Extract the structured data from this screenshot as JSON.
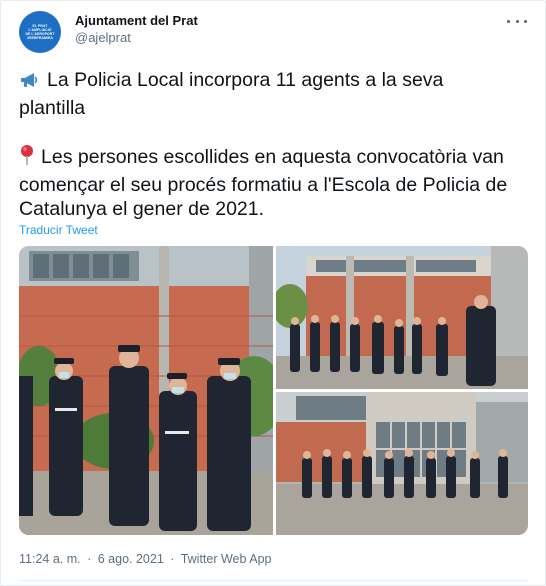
{
  "account": {
    "display_name": "Ajuntament del Prat",
    "handle": "@ajelprat",
    "avatar_lines": [
      "EL PRAT",
      "L'AMPLIACIÓ",
      "DE L'AEROPORT",
      "#REBPRAMIEA"
    ],
    "avatar_color": "#1d6fc4"
  },
  "menu_icon": "more-horizontal-icon",
  "tweet": {
    "paragraph_1_emoji": "📣",
    "paragraph_1": "La Policia Local incorpora 11 agents a la seva plantilla",
    "paragraph_2_emoji": "📍",
    "paragraph_2": "Les persones escollides en aquesta convocatòria van començar el seu procés formatiu a l'Escola de Policia de Catalunya el gener de 2021.",
    "translate_link": "Traducir Tweet"
  },
  "photos": {
    "count": 3
  },
  "meta": {
    "time": "11:24 a. m.",
    "separator": "·",
    "date": "6 ago. 2021",
    "source": "Twitter Web App"
  },
  "colors": {
    "link": "#1d9bf0",
    "muted": "#5b7083",
    "text": "#0f1419"
  }
}
